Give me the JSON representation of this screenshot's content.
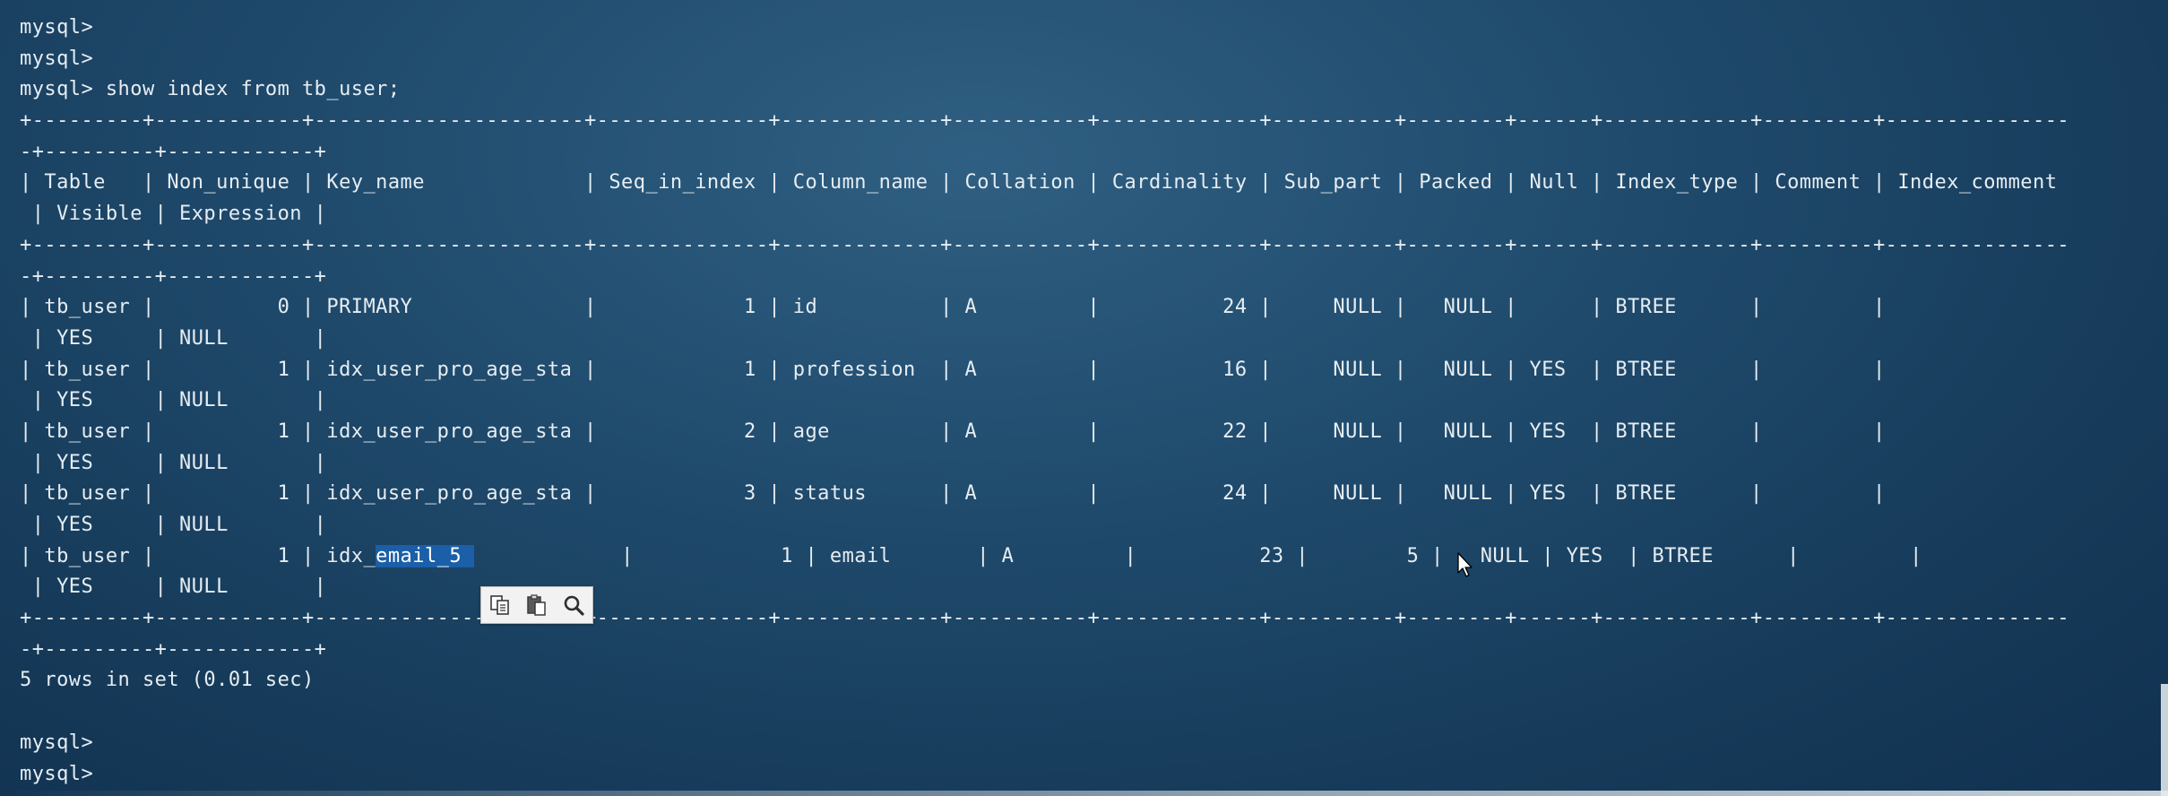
{
  "terminal": {
    "lines": [
      "mysql>",
      "mysql>",
      "mysql> show index from tb_user;",
      "+---------+------------+----------------------+--------------+-------------+-----------+-------------+----------+--------+------+------------+---------+---------------",
      "-+---------+------------+",
      "| Table   | Non_unique | Key_name             | Seq_in_index | Column_name | Collation | Cardinality | Sub_part | Packed | Null | Index_type | Comment | Index_comment",
      " | Visible | Expression |",
      "+---------+------------+----------------------+--------------+-------------+-----------+-------------+----------+--------+------+------------+---------+---------------",
      "-+---------+------------+",
      "| tb_user |          0 | PRIMARY              |            1 | id          | A         |          24 |     NULL |   NULL |      | BTREE      |         |",
      " | YES     | NULL       |",
      "| tb_user |          1 | idx_user_pro_age_sta |            1 | profession  | A         |          16 |     NULL |   NULL | YES  | BTREE      |         |",
      " | YES     | NULL       |",
      "| tb_user |          1 | idx_user_pro_age_sta |            2 | age         | A         |          22 |     NULL |   NULL | YES  | BTREE      |         |",
      " | YES     | NULL       |",
      "| tb_user |          1 | idx_user_pro_age_sta |            3 | status      | A         |          24 |     NULL |   NULL | YES  | BTREE      |         |",
      " | YES     | NULL       |",
      null,
      " | YES     | NULL       |",
      "+---------+------------+----------------------+--------------+-------------+-----------+-------------+----------+--------+------+------------+---------+---------------",
      "-+---------+------------+",
      "5 rows in set (0.01 sec)",
      "",
      "mysql>",
      "mysql>"
    ],
    "selected_row": {
      "before": "| tb_user |          1 | idx_",
      "selected": "email_5 ",
      "after": "            |            1 | email       | A         |          23 |        5 |   NULL | YES  | BTREE      |         |"
    }
  },
  "popup": {
    "copy_icon": "copy-icon",
    "paste_icon": "paste-icon",
    "search_icon": "search-icon"
  },
  "colors": {
    "background": "#1f4a6c",
    "text": "#e6edf2",
    "selection": "#1a5fa8"
  }
}
